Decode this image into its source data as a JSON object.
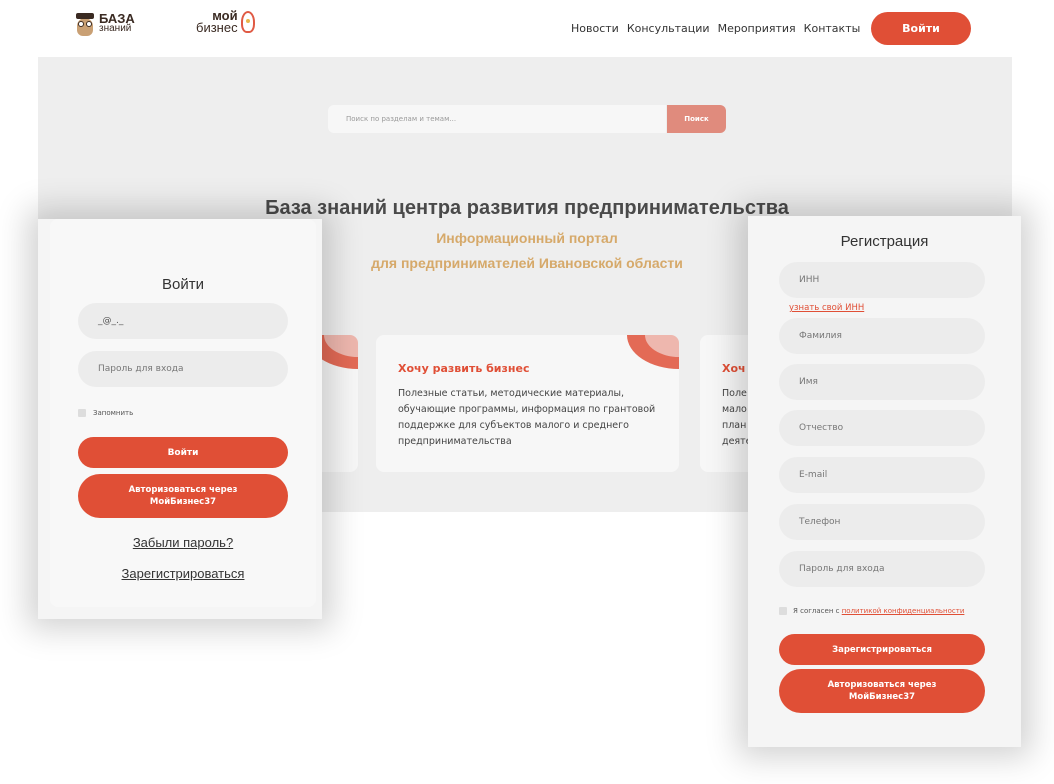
{
  "header": {
    "logo1": {
      "line1": "БАЗА",
      "line2": "знаний"
    },
    "logo2": {
      "line1": "мой",
      "line2": "бизнес"
    },
    "nav": [
      "Новости",
      "Консультации",
      "Мероприятия",
      "Контакты"
    ],
    "login_button": "Войти"
  },
  "search": {
    "placeholder": "Поиск по разделам и темам...",
    "button": "Поиск"
  },
  "hero": {
    "title": "База знаний центра развития предпринимательства",
    "subtitle_line1": "Информационный портал",
    "subtitle_line2": "для предпринимателей Ивановской области"
  },
  "cards": [
    {
      "title": "Хочу развить бизнес",
      "text": "Полезные статьи, методические материалы, обучающие программы, информация по грантовой поддержке для субъектов малого и среднего предпринимательства"
    },
    {
      "title": "Хоч",
      "text": "Поле мало план деяте"
    }
  ],
  "login": {
    "title": "Войти",
    "login_value": "_@_._",
    "password_placeholder": "Пароль для входа",
    "remember_label": "Запомнить",
    "submit": "Войти",
    "oauth_line1": "Авторизоваться через",
    "oauth_line2": "МойБизнес37",
    "forgot": "Забыли пароль?",
    "register": "Зарегистрироваться"
  },
  "registration": {
    "title": "Регистрация",
    "inn_placeholder": "ИНН",
    "inn_link": "узнать свой ИНН",
    "surname_placeholder": "Фамилия",
    "name_placeholder": "Имя",
    "patronymic_placeholder": "Отчество",
    "email_placeholder": "E-mail",
    "phone_placeholder": "Телефон",
    "password_placeholder": "Пароль для входа",
    "consent_prefix": "Я согласен с",
    "consent_link": "политикой конфиденциальности",
    "submit": "Зарегистрироваться",
    "oauth_line1": "Авторизоваться через",
    "oauth_line2": "МойБизнес37"
  },
  "colors": {
    "accent": "#e04f36",
    "subtitle": "#d6a96a",
    "background": "#eeeeee"
  }
}
